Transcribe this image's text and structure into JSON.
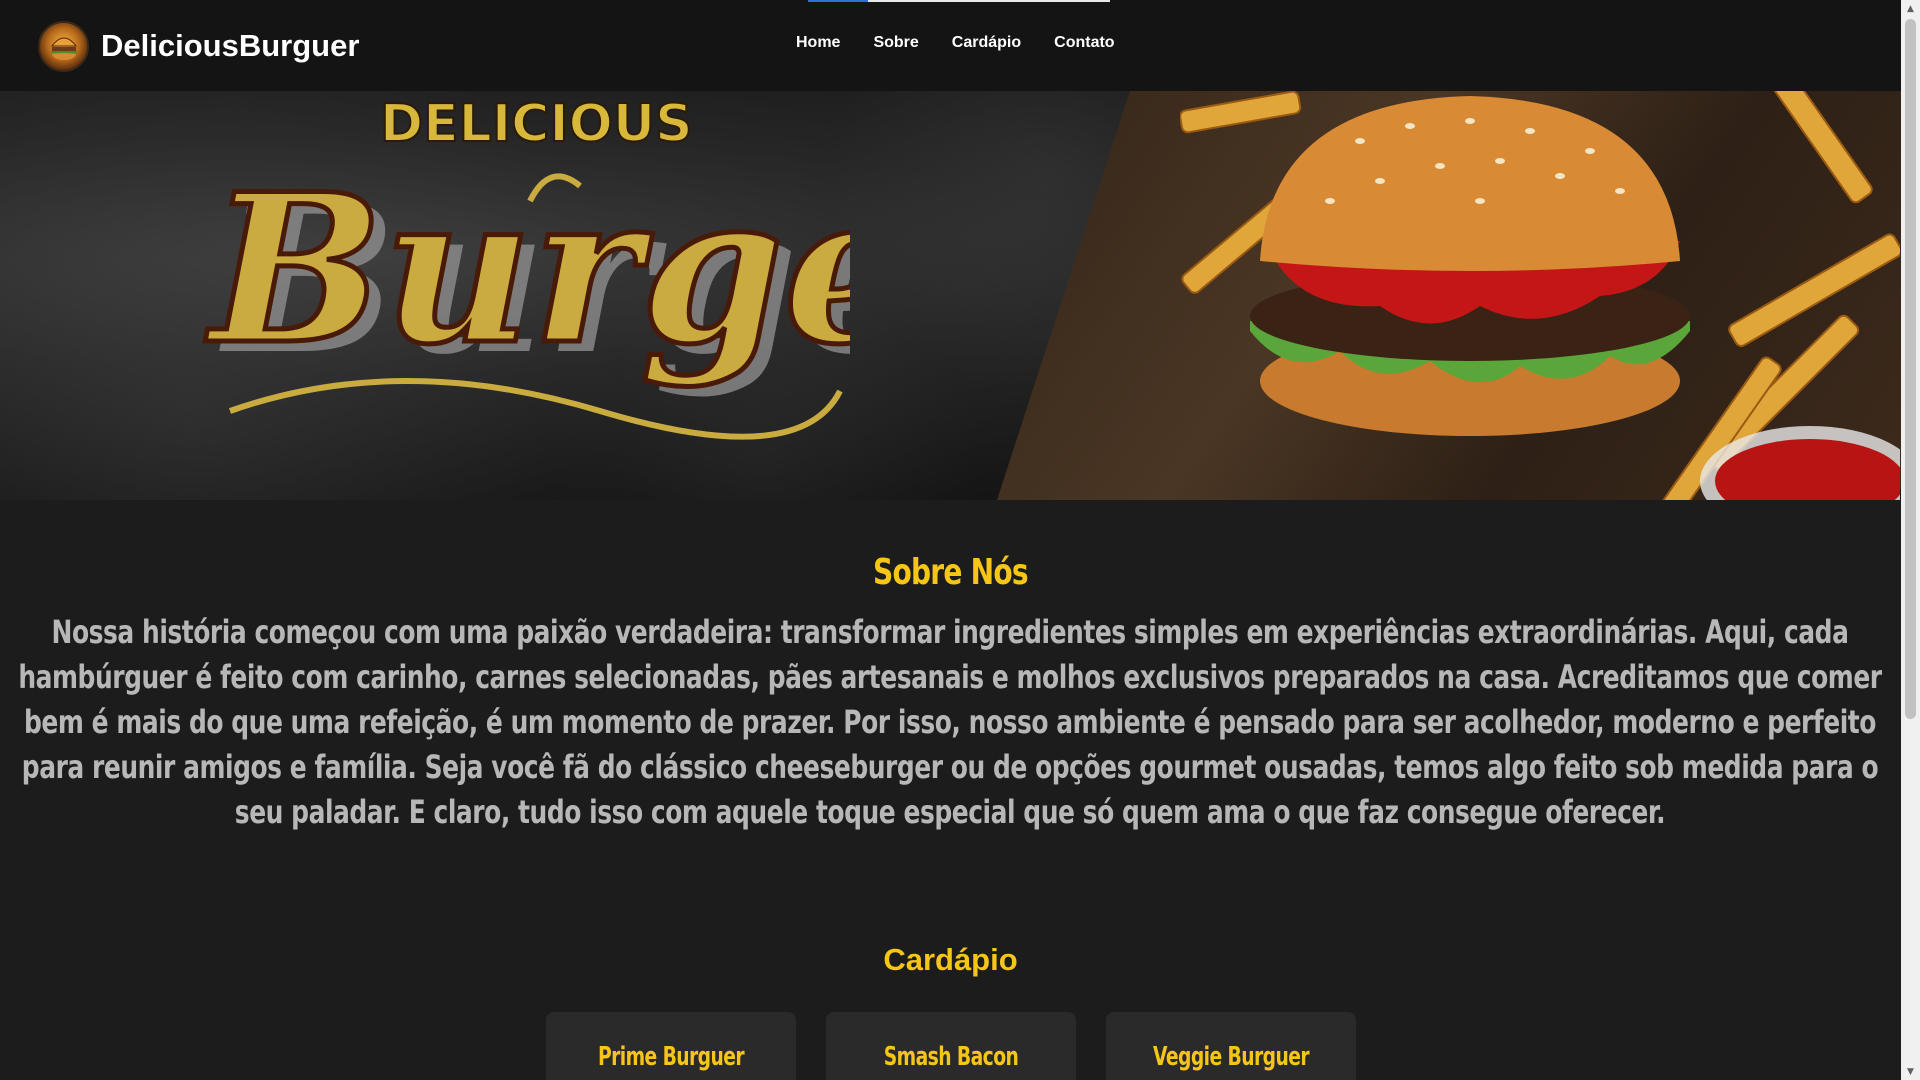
{
  "navbar": {
    "brand_name": "DeliciousBurguer",
    "links": [
      "Home",
      "Sobre",
      "Cardápio",
      "Contato"
    ]
  },
  "hero": {
    "logo_word_top": "DELICIOUS",
    "logo_word_main": "Burger"
  },
  "about": {
    "title": "Sobre Nós",
    "text": "Nossa história começou com uma paixão verdadeira: transformar ingredientes simples em experiências extraordinárias. Aqui, cada hambúrguer é feito com carinho, carnes selecionadas, pães artesanais e molhos exclusivos preparados na casa. Acreditamos que comer bem é mais do que uma refeição, é um momento de prazer. Por isso, nosso ambiente é pensado para ser acolhedor, moderno e perfeito para reunir amigos e família. Seja você fã do clássico cheeseburger ou de opções gourmet ousadas, temos algo feito sob medida para o seu paladar. E claro, tudo isso com aquele toque especial que só quem ama o que faz consegue oferecer."
  },
  "menu": {
    "title": "Cardápio",
    "items": [
      "Prime Burguer",
      "Smash Bacon",
      "Veggie Burguer"
    ]
  },
  "colors": {
    "accent_yellow": "#f5c518",
    "background": "#1c1c1c",
    "navbar": "#141414",
    "card": "#2a2a2a",
    "body_text": "#b7b7b7"
  },
  "icons": {
    "scroll_up": "▲",
    "scroll_down": "▼"
  }
}
